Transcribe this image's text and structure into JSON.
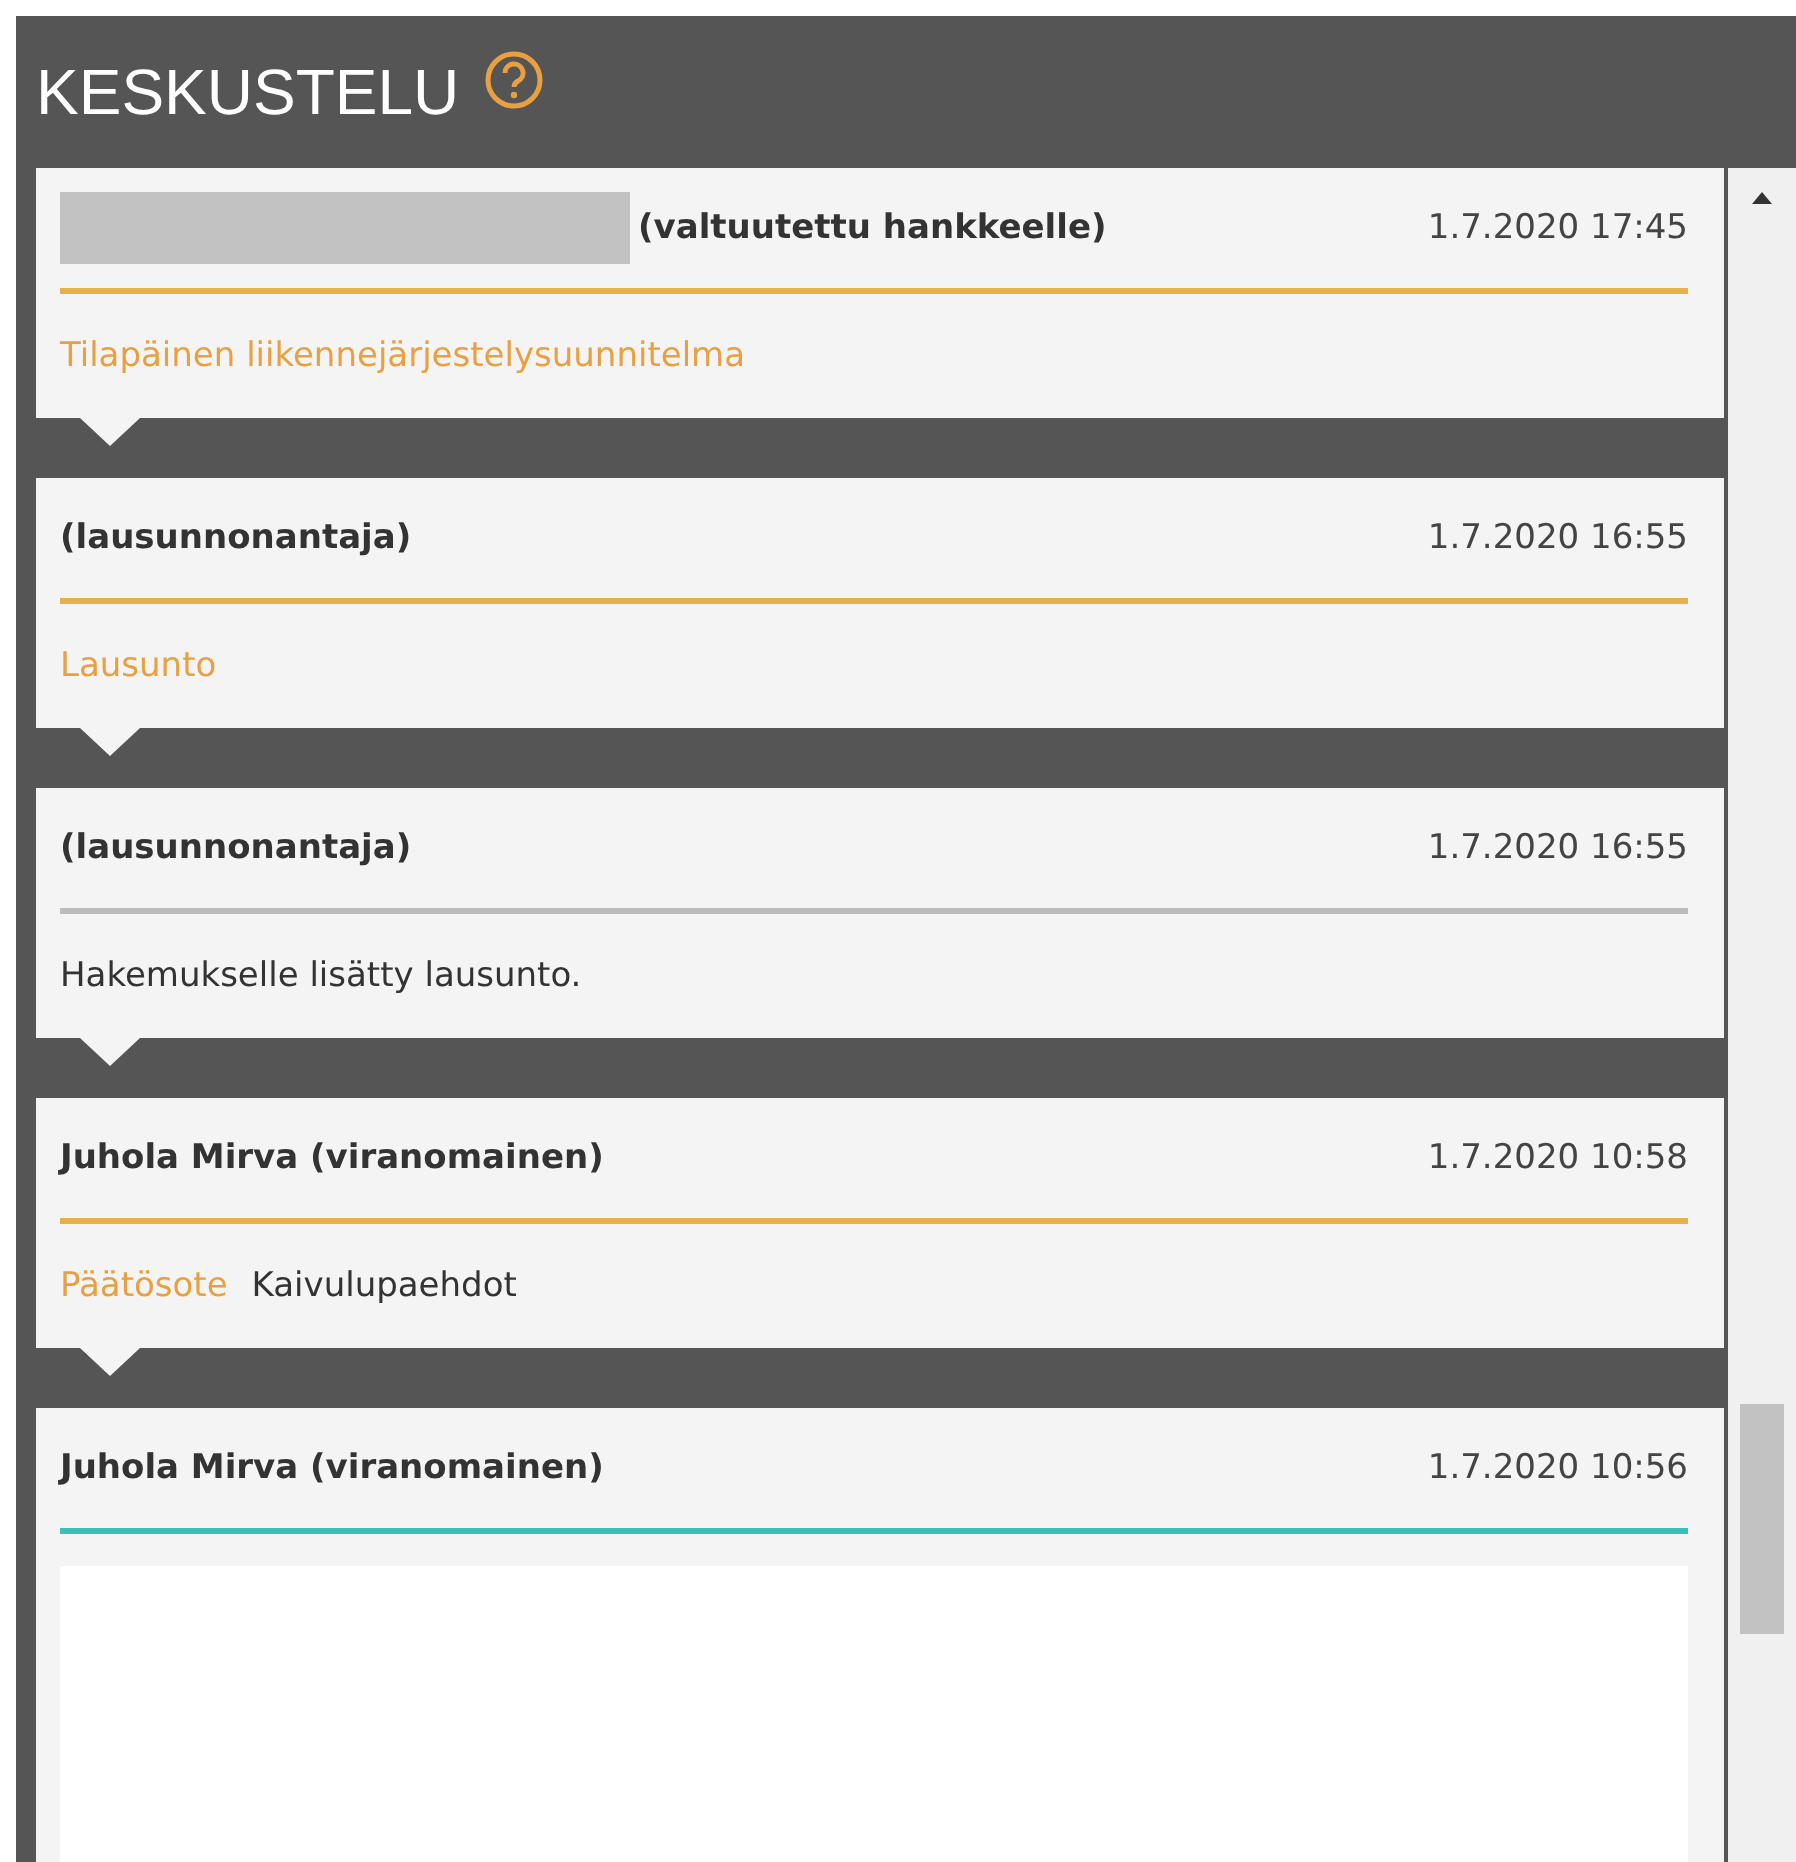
{
  "panel": {
    "title": "KESKUSTELU"
  },
  "messages": [
    {
      "redacted_name": true,
      "author": "(valtuutettu hankkeelle)",
      "time": "1.7.2020 17:45",
      "color": "#e8b04a",
      "body": [
        {
          "kind": "link",
          "text": "Tilapäinen liikennejärjestelysuunnitelma"
        }
      ]
    },
    {
      "redacted_name": false,
      "author": "(lausunnonantaja)",
      "time": "1.7.2020 16:55",
      "color": "#e8b04a",
      "body": [
        {
          "kind": "link",
          "text": "Lausunto"
        }
      ]
    },
    {
      "redacted_name": false,
      "author": "(lausunnonantaja)",
      "time": "1.7.2020 16:55",
      "color": "#bcbcbc",
      "body": [
        {
          "kind": "text",
          "text": "Hakemukselle lisätty lausunto."
        }
      ]
    },
    {
      "redacted_name": false,
      "author": "Juhola Mirva (viranomainen)",
      "time": "1.7.2020 10:58",
      "color": "#e8b04a",
      "body": [
        {
          "kind": "link",
          "text": "Päätösote"
        },
        {
          "kind": "text",
          "text": "Kaivulupaehdot"
        }
      ]
    },
    {
      "redacted_name": false,
      "author": "Juhola Mirva (viranomainen)",
      "time": "1.7.2020 10:56",
      "color": "#3bbfb8",
      "body": [
        {
          "kind": "textarea"
        }
      ]
    }
  ]
}
